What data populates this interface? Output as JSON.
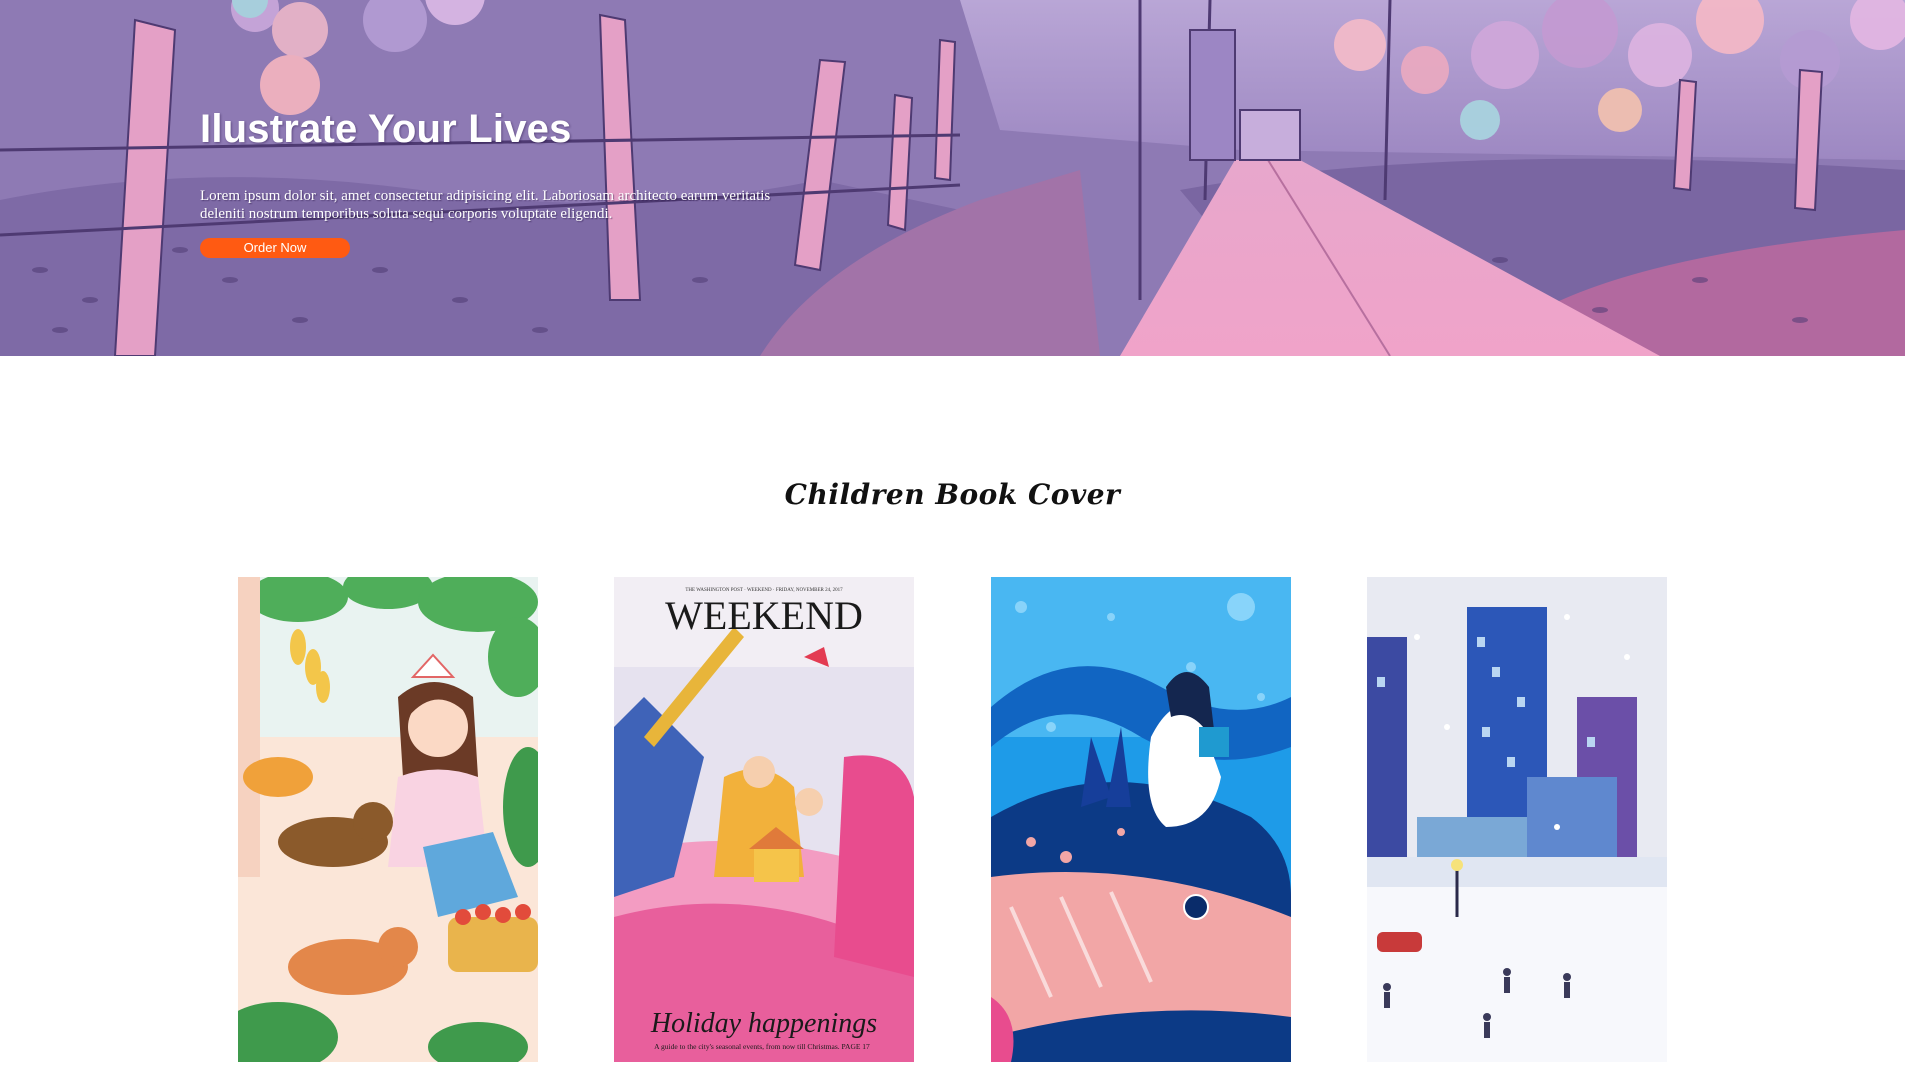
{
  "hero": {
    "title": "Ilustrate Your Lives",
    "text": "Lorem ipsum dolor sit, amet consectetur adipisicing elit. Laboriosam architecto earum veritatis deleniti nostrum temporibus soluta sequi corporis voluptate eligendi.",
    "button_label": "Order Now",
    "button_color": "#ff5a12"
  },
  "section": {
    "title": "Children Book Cover"
  },
  "covers": [
    {
      "name": "girl-with-cats-cover",
      "header": "",
      "title": "",
      "subtitle": ""
    },
    {
      "name": "weekend-holiday-cover",
      "header": "THE WASHINGTON POST · WEEKEND · FRIDAY, NOVEMBER 24, 2017",
      "title": "WEEKEND",
      "subtitle": "Holiday happenings",
      "caption": "A guide to the city's seasonal events, from now till Christmas.",
      "page": "PAGE 17"
    },
    {
      "name": "girl-on-whale-cover",
      "header": "",
      "title": "",
      "subtitle": ""
    },
    {
      "name": "winter-city-cover",
      "header": "",
      "title": "",
      "subtitle": ""
    }
  ]
}
